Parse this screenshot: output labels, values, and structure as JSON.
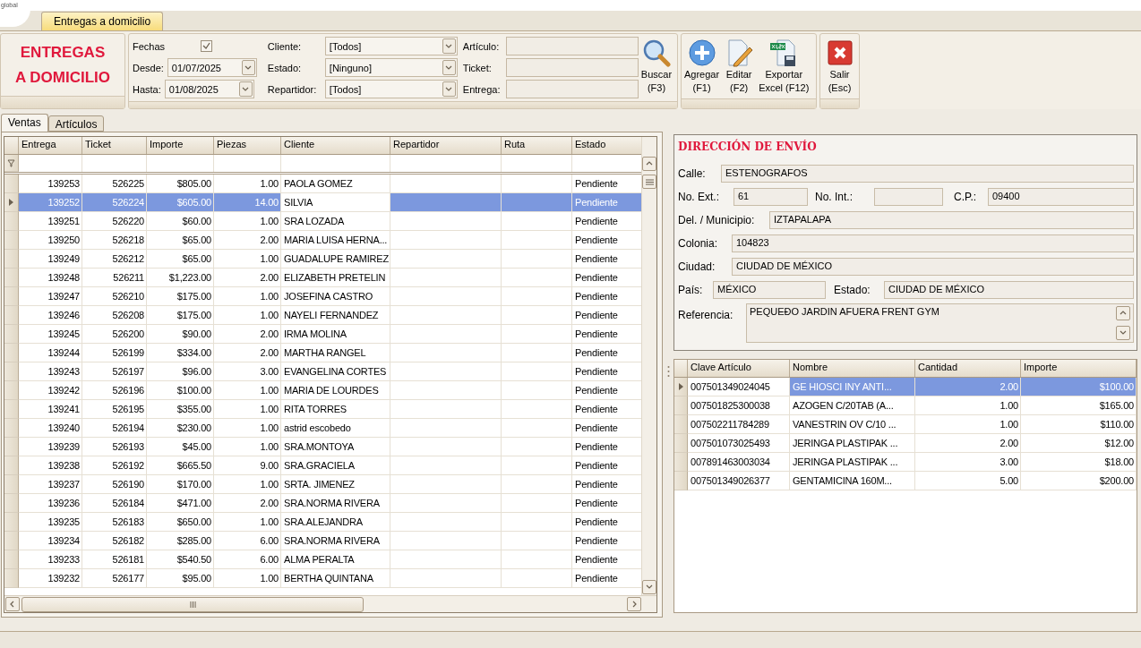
{
  "logo": {
    "text": "global"
  },
  "doc_tabs": [
    {
      "label": "Entregas a domicilio",
      "selected": true
    }
  ],
  "ribbon": {
    "title_lines": [
      "ENTREGAS",
      "A DOMICILIO"
    ],
    "fechas": {
      "label": "Fechas",
      "checked": true
    },
    "desde": {
      "label": "Desde:",
      "value": "01/07/2025"
    },
    "hasta": {
      "label": "Hasta:",
      "value": "01/08/2025"
    },
    "combos": [
      {
        "label": "Cliente:",
        "value": "[Todos]"
      },
      {
        "label": "Estado:",
        "value": "[Ninguno]"
      },
      {
        "label": "Repartidor:",
        "value": "[Todos]"
      }
    ],
    "text_fields": [
      {
        "label": "Artículo:"
      },
      {
        "label": "Ticket:"
      },
      {
        "label": "Entrega:"
      }
    ],
    "buttons": [
      {
        "kind": "search",
        "label": "Buscar",
        "key": "(F3)"
      },
      {
        "kind": "add",
        "label": "Agregar",
        "key": "(F1)"
      },
      {
        "kind": "edit",
        "label": "Editar",
        "key": "(F2)"
      },
      {
        "kind": "excel",
        "label": "Exportar",
        "key": "Excel (F12)"
      },
      {
        "kind": "exit",
        "label": "Salir",
        "key": "(Esc)"
      }
    ]
  },
  "view_tabs": [
    {
      "label": "Ventas",
      "selected": true
    },
    {
      "label": "Artículos",
      "selected": false
    }
  ],
  "sales_table": {
    "columns": [
      {
        "label": "Entrega",
        "focused": false
      },
      {
        "label": "Ticket",
        "focused": false
      },
      {
        "label": "Importe",
        "focused": false
      },
      {
        "label": "Piezas",
        "focused": false
      },
      {
        "label": "Cliente",
        "focused": true
      },
      {
        "label": "Repartidor",
        "focused": false
      },
      {
        "label": "Ruta",
        "focused": false
      },
      {
        "label": "Estado",
        "focused": false
      }
    ],
    "rows": [
      {
        "entrega": "139253",
        "ticket": "526225",
        "importe": "$805.00",
        "piezas": "1.00",
        "cliente": "PAOLA GOMEZ",
        "estado": "Pendiente",
        "selected": false
      },
      {
        "entrega": "139252",
        "ticket": "526224",
        "importe": "$605.00",
        "piezas": "14.00",
        "cliente": "SILVIA",
        "estado": "Pendiente",
        "selected": true
      },
      {
        "entrega": "139251",
        "ticket": "526220",
        "importe": "$60.00",
        "piezas": "1.00",
        "cliente": "SRA LOZADA",
        "estado": "Pendiente",
        "selected": false
      },
      {
        "entrega": "139250",
        "ticket": "526218",
        "importe": "$65.00",
        "piezas": "2.00",
        "cliente": "MARIA LUISA HERNA...",
        "estado": "Pendiente",
        "selected": false
      },
      {
        "entrega": "139249",
        "ticket": "526212",
        "importe": "$65.00",
        "piezas": "1.00",
        "cliente": "GUADALUPE RAMIREZ",
        "estado": "Pendiente",
        "selected": false
      },
      {
        "entrega": "139248",
        "ticket": "526211",
        "importe": "$1,223.00",
        "piezas": "2.00",
        "cliente": "ELIZABETH PRETELIN",
        "estado": "Pendiente",
        "selected": false
      },
      {
        "entrega": "139247",
        "ticket": "526210",
        "importe": "$175.00",
        "piezas": "1.00",
        "cliente": "JOSEFINA CASTRO",
        "estado": "Pendiente",
        "selected": false
      },
      {
        "entrega": "139246",
        "ticket": "526208",
        "importe": "$175.00",
        "piezas": "1.00",
        "cliente": "NAYELI FERNANDEZ",
        "estado": "Pendiente",
        "selected": false
      },
      {
        "entrega": "139245",
        "ticket": "526200",
        "importe": "$90.00",
        "piezas": "2.00",
        "cliente": "IRMA MOLINA",
        "estado": "Pendiente",
        "selected": false
      },
      {
        "entrega": "139244",
        "ticket": "526199",
        "importe": "$334.00",
        "piezas": "2.00",
        "cliente": "MARTHA RANGEL",
        "estado": "Pendiente",
        "selected": false
      },
      {
        "entrega": "139243",
        "ticket": "526197",
        "importe": "$96.00",
        "piezas": "3.00",
        "cliente": "EVANGELINA CORTES",
        "estado": "Pendiente",
        "selected": false
      },
      {
        "entrega": "139242",
        "ticket": "526196",
        "importe": "$100.00",
        "piezas": "1.00",
        "cliente": "MARIA DE LOURDES",
        "estado": "Pendiente",
        "selected": false
      },
      {
        "entrega": "139241",
        "ticket": "526195",
        "importe": "$355.00",
        "piezas": "1.00",
        "cliente": "RITA TORRES",
        "estado": "Pendiente",
        "selected": false
      },
      {
        "entrega": "139240",
        "ticket": "526194",
        "importe": "$230.00",
        "piezas": "1.00",
        "cliente": "astrid escobedo",
        "estado": "Pendiente",
        "selected": false
      },
      {
        "entrega": "139239",
        "ticket": "526193",
        "importe": "$45.00",
        "piezas": "1.00",
        "cliente": "SRA.MONTOYA",
        "estado": "Pendiente",
        "selected": false
      },
      {
        "entrega": "139238",
        "ticket": "526192",
        "importe": "$665.50",
        "piezas": "9.00",
        "cliente": "SRA.GRACIELA",
        "estado": "Pendiente",
        "selected": false
      },
      {
        "entrega": "139237",
        "ticket": "526190",
        "importe": "$170.00",
        "piezas": "1.00",
        "cliente": "SRTA. JIMENEZ",
        "estado": "Pendiente",
        "selected": false
      },
      {
        "entrega": "139236",
        "ticket": "526184",
        "importe": "$471.00",
        "piezas": "2.00",
        "cliente": "SRA.NORMA RIVERA",
        "estado": "Pendiente",
        "selected": false
      },
      {
        "entrega": "139235",
        "ticket": "526183",
        "importe": "$650.00",
        "piezas": "1.00",
        "cliente": "SRA.ALEJANDRA",
        "estado": "Pendiente",
        "selected": false
      },
      {
        "entrega": "139234",
        "ticket": "526182",
        "importe": "$285.00",
        "piezas": "6.00",
        "cliente": "SRA.NORMA RIVERA",
        "estado": "Pendiente",
        "selected": false
      },
      {
        "entrega": "139233",
        "ticket": "526181",
        "importe": "$540.50",
        "piezas": "6.00",
        "cliente": "ALMA PERALTA",
        "estado": "Pendiente",
        "selected": false
      },
      {
        "entrega": "139232",
        "ticket": "526177",
        "importe": "$95.00",
        "piezas": "1.00",
        "cliente": "BERTHA QUINTANA",
        "estado": "Pendiente",
        "selected": false
      }
    ]
  },
  "address": {
    "title": "DIRECCIÓN DE ENVÍO",
    "calle": {
      "label": "Calle:",
      "value": "ESTENOGRAFOS"
    },
    "no_ext": {
      "label": "No. Ext.:",
      "value": "61"
    },
    "no_int": {
      "label": "No. Int.:"
    },
    "cp": {
      "label": "C.P.:",
      "value": "09400"
    },
    "municipio": {
      "label": "Del. / Municipio:",
      "value": "IZTAPALAPA"
    },
    "colonia": {
      "label": "Colonia:",
      "value": "104823"
    },
    "ciudad": {
      "label": "Ciudad:",
      "value": "CIUDAD DE MÉXICO"
    },
    "pais": {
      "label": "País:",
      "value": "MÉXICO"
    },
    "estado": {
      "label": "Estado:",
      "value": "CIUDAD DE MÉXICO"
    },
    "referencia": {
      "label": "Referencia:",
      "value": "PEQUEĐO JARDIN AFUERA FRENT GYM"
    }
  },
  "items_table": {
    "columns": [
      {
        "label": "Clave Artículo",
        "focused": true
      },
      {
        "label": "Nombre",
        "focused": false
      },
      {
        "label": "Cantidad",
        "focused": false
      },
      {
        "label": "Importe",
        "focused": false
      }
    ],
    "rows": [
      {
        "clave": "007501349024045",
        "nombre": "GE HIOSCI INY ANTI...",
        "cantidad": "2.00",
        "importe": "$100.00",
        "selected": true
      },
      {
        "clave": "007501825300038",
        "nombre": "AZOGEN C/20TAB (A...",
        "cantidad": "1.00",
        "importe": "$165.00",
        "selected": false
      },
      {
        "clave": "007502211784289",
        "nombre": "VANESTRIN OV C/10 ...",
        "cantidad": "1.00",
        "importe": "$110.00",
        "selected": false
      },
      {
        "clave": "007501073025493",
        "nombre": "JERINGA PLASTIPAK ...",
        "cantidad": "2.00",
        "importe": "$12.00",
        "selected": false
      },
      {
        "clave": "007891463003034",
        "nombre": "JERINGA PLASTIPAK ...",
        "cantidad": "3.00",
        "importe": "$18.00",
        "selected": false
      },
      {
        "clave": "007501349026377",
        "nombre": "GENTAMICINA 160M...",
        "cantidad": "5.00",
        "importe": "$200.00",
        "selected": false
      }
    ]
  }
}
